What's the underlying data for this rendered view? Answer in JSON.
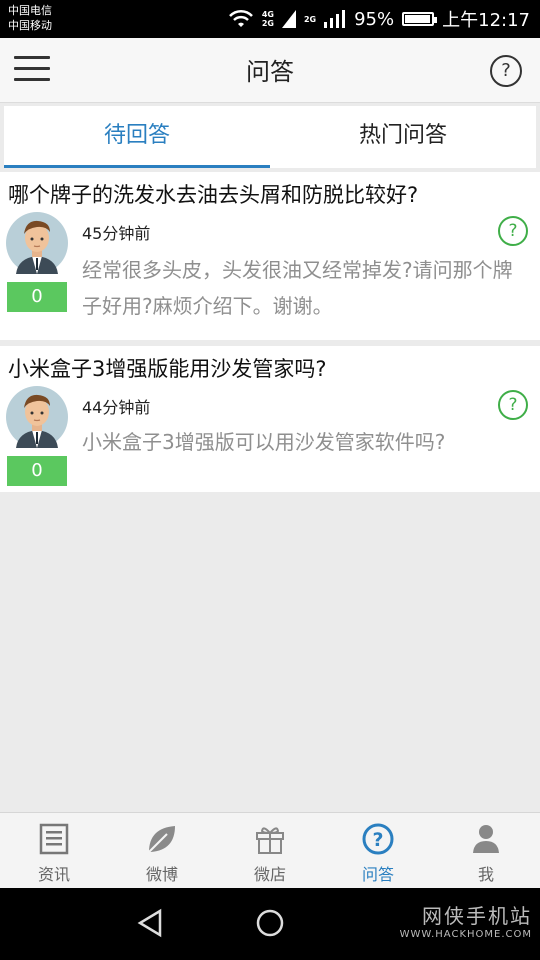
{
  "status_bar": {
    "carrier_1": "中国电信",
    "carrier_2": "中国移动",
    "network_1": "4G",
    "network_1b": "2G",
    "network_2": "2G",
    "battery": "95%",
    "battery_level": 0.95,
    "time": "上午12:17"
  },
  "header": {
    "title": "问答",
    "help_label": "?"
  },
  "tabs": [
    {
      "label": "待回答",
      "active": true
    },
    {
      "label": "热门问答",
      "active": false
    }
  ],
  "questions": [
    {
      "title": "哪个牌子的洗发水去油去头屑和防脱比较好?",
      "time": "45分钟前",
      "description": "经常很多头皮，头发很油又经常掉发?请问那个牌子好用?麻烦介绍下。谢谢。",
      "answer_count": "0"
    },
    {
      "title": "小米盒子3增强版能用沙发管家吗?",
      "time": "44分钟前",
      "description": "小米盒子3增强版可以用沙发管家软件吗?",
      "answer_count": "0"
    }
  ],
  "bottom_nav": [
    {
      "label": "资讯",
      "icon": "news-icon"
    },
    {
      "label": "微博",
      "icon": "leaf-icon"
    },
    {
      "label": "微店",
      "icon": "gift-icon"
    },
    {
      "label": "问答",
      "icon": "question-icon",
      "active": true
    },
    {
      "label": "我",
      "icon": "person-icon"
    }
  ],
  "watermark": {
    "name": "网侠手机站",
    "url": "WWW.HACKHOME.COM"
  },
  "colors": {
    "accent": "#2a7fc0",
    "answer_badge": "#5bc85f",
    "answer_icon": "#3fae48"
  }
}
